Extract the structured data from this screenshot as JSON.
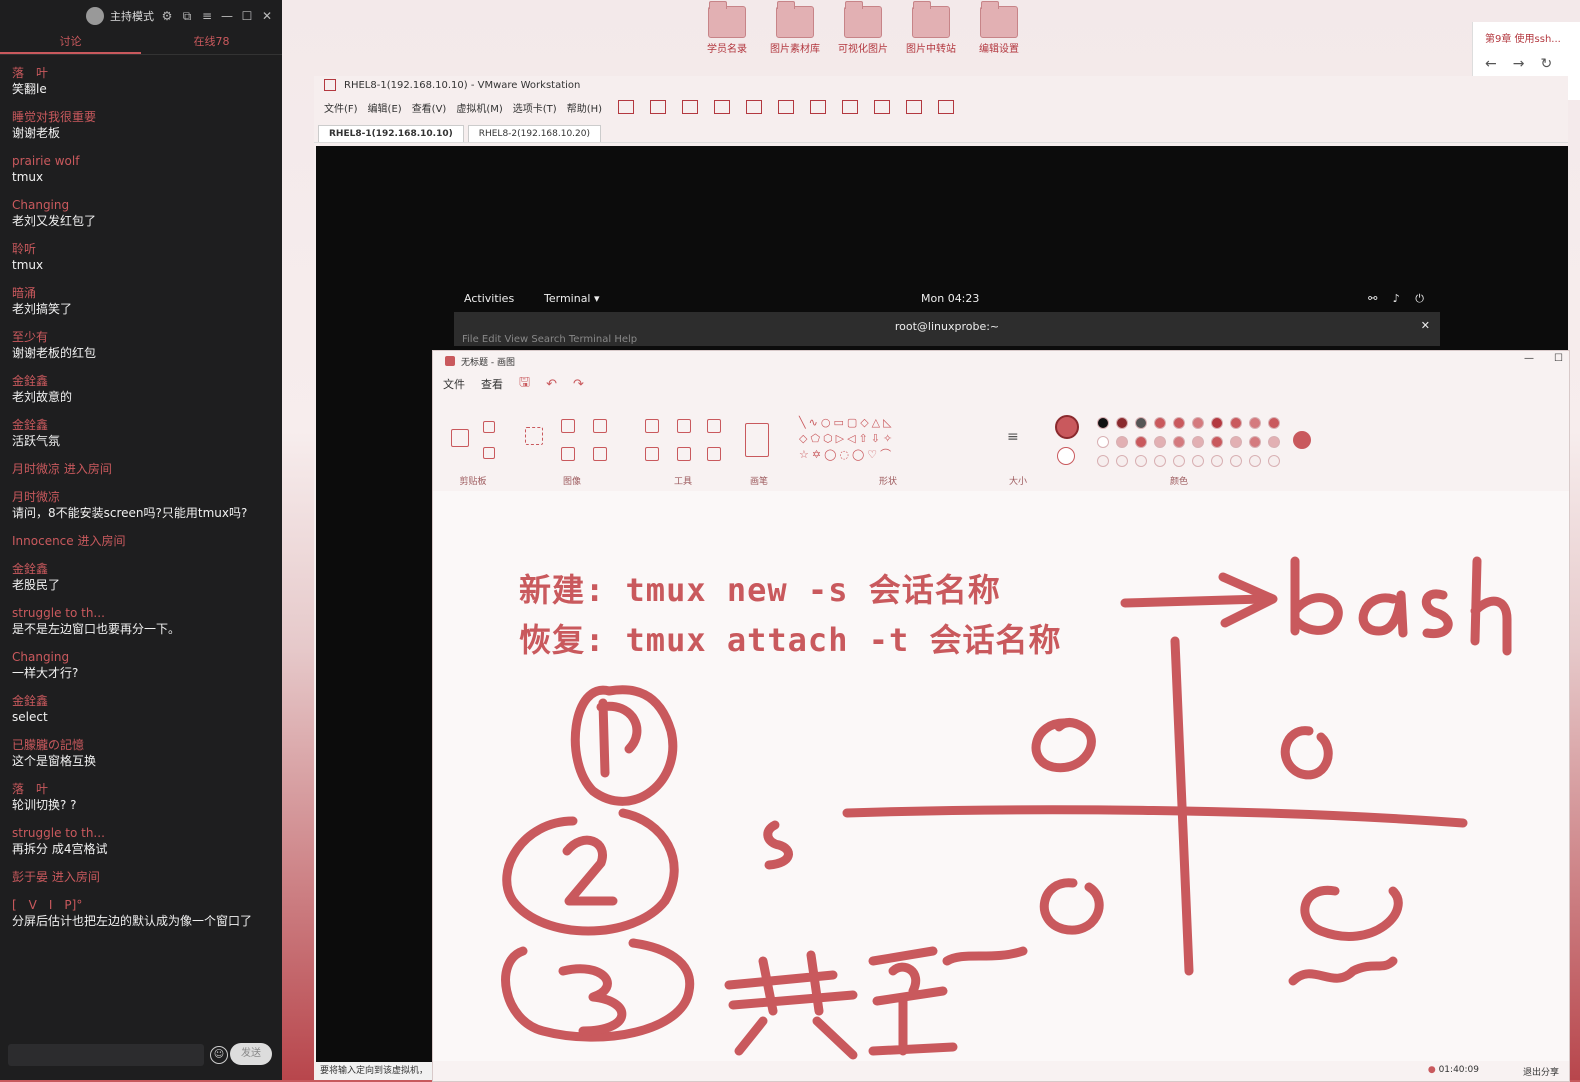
{
  "chat": {
    "title": "主持模式",
    "tabs": [
      "讨论",
      "在线78"
    ],
    "messages": [
      {
        "name": "落　叶",
        "text": "笑翻le"
      },
      {
        "name": "睡觉对我很重要",
        "text": "谢谢老板"
      },
      {
        "name": "prairie wolf",
        "text": "tmux"
      },
      {
        "name": "Changing",
        "text": "老刘又发红包了"
      },
      {
        "name": "聆听",
        "text": "tmux"
      },
      {
        "name": "暗涌",
        "text": "老刘搞笑了"
      },
      {
        "name": "至少有",
        "text": "谢谢老板的红包"
      },
      {
        "name": "金銓鑫",
        "text": "老刘故意的"
      },
      {
        "name": "金銓鑫",
        "text": "活跃气氛"
      },
      {
        "name": "月时微凉 进入房间",
        "text": ""
      },
      {
        "name": "月时微凉",
        "text": "请问，8不能安装screen吗?只能用tmux吗?"
      },
      {
        "name": "Innocence 进入房间",
        "text": ""
      },
      {
        "name": "金銓鑫",
        "text": "老股民了"
      },
      {
        "name": "struggle to th...",
        "text": "是不是左边窗口也要再分一下。"
      },
      {
        "name": "Changing",
        "text": "一样大才行?"
      },
      {
        "name": "金銓鑫",
        "text": "select"
      },
      {
        "name": "已朦朧の記憶",
        "text": "这个是窗格互换"
      },
      {
        "name": "落　叶",
        "text": "轮训切换? ?"
      },
      {
        "name": "struggle to th...",
        "text": "再拆分 成4宫格试"
      },
      {
        "name": "彭于晏 进入房间",
        "text": ""
      },
      {
        "name": "[　V　I　P]°",
        "text": "分屏后估计也把左边的默认成为像一个窗口了"
      }
    ],
    "send_label": "发送"
  },
  "desktop": {
    "icons": [
      "学员名录",
      "图片素材库",
      "可视化图片",
      "图片中转站",
      "编辑设置"
    ]
  },
  "browser": {
    "tab": "第9章 使用ssh..."
  },
  "vmware": {
    "title": "RHEL8-1(192.168.10.10) - VMware Workstation",
    "menu": [
      "文件(F)",
      "编辑(E)",
      "查看(V)",
      "虚拟机(M)",
      "选项卡(T)",
      "帮助(H)"
    ],
    "tabs": [
      "RHEL8-1(192.168.10.10)",
      "RHEL8-2(192.168.10.20)"
    ],
    "status": "要将输入定向到该虚拟机，"
  },
  "gnome": {
    "activities": "Activities",
    "app": "Terminal ▾",
    "clock": "Mon 04:23",
    "terminal_title": "root@linuxprobe:~",
    "terminal_menu": "File  Edit  View  Search  Terminal  Help"
  },
  "paint": {
    "title": "无标题 - 画图",
    "menu": [
      "文件",
      "查看"
    ],
    "groups": [
      "剪贴板",
      "图像",
      "工具",
      "画笔",
      "形状",
      "大小",
      "颜色"
    ],
    "lines": [
      "新建: tmux new -s 会话名称",
      "恢复: tmux attach -t 会话名称"
    ],
    "status_time": "01:40:09",
    "status_share": "退出分享"
  }
}
